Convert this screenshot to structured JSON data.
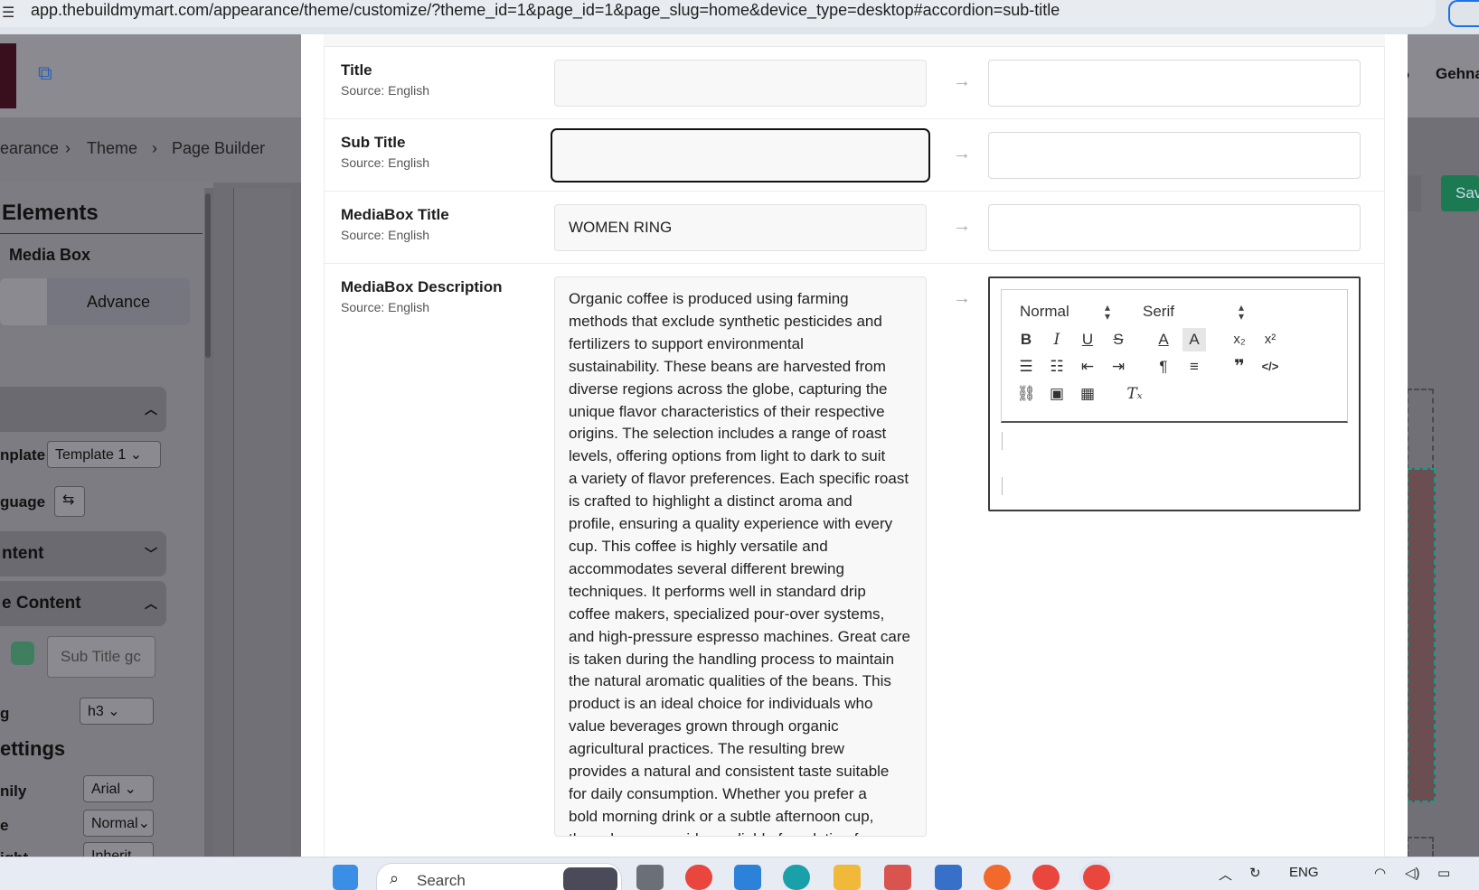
{
  "browser": {
    "url": "app.thebuildmymart.com/appearance/theme/customize/?theme_id=1&page_id=1&page_slug=home&device_type=desktop#accordion=sub-title"
  },
  "header": {
    "user_name": "Gehna"
  },
  "breadcrumb": {
    "items": [
      "earance",
      "Theme",
      "Page Builder"
    ]
  },
  "sidebar": {
    "title": "Elements",
    "element_name": "Media Box",
    "tab_advance": "Advance",
    "template_label": "nplate",
    "template_value": "Template 1",
    "language_label": "guage",
    "content_section": "ntent",
    "title_content_section": "e Content",
    "subtitle_placeholder": "Sub Title gc",
    "tag_label": "g",
    "tag_value": "h3",
    "settings_title": "ettings",
    "font_family_label": "nily",
    "font_family_value": "Arial",
    "font_style_label": "e",
    "font_style_value": "Normal",
    "font_weight_label": "ight",
    "font_weight_value": "Inherit"
  },
  "toolbar_bg": {
    "save_label": "Sav"
  },
  "modal": {
    "rows": [
      {
        "label": "Title",
        "source": "Source: English",
        "value": ""
      },
      {
        "label": "Sub Title",
        "source": "Source: English",
        "value": ""
      },
      {
        "label": "MediaBox Title",
        "source": "Source: English",
        "value": "WOMEN RING"
      },
      {
        "label": "MediaBox Description",
        "source": "Source: English"
      }
    ],
    "description_lines": [
      "Organic coffee is produced using farming",
      "methods that exclude synthetic pesticides and",
      "fertilizers to support environmental",
      "sustainability. These beans are harvested from",
      "diverse regions across the globe, capturing the",
      "unique flavor characteristics of their respective",
      "origins. The selection includes a range of roast",
      "levels, offering options from light to dark to suit",
      "a variety of flavor preferences. Each specific roast",
      "is crafted to highlight a distinct aroma and",
      "profile, ensuring a quality experience with every",
      "cup. This coffee is highly versatile and",
      "accommodates several different brewing",
      "techniques. It performs well in standard drip",
      "coffee makers, specialized pour-over systems,",
      "and high-pressure espresso machines. Great care",
      "is taken during the handling process to maintain",
      "the natural aromatic qualities of the beans. This",
      "product is an ideal choice for individuals who",
      "value beverages grown through organic",
      "agricultural practices. The resulting brew",
      "provides a natural and consistent taste suitable",
      "for daily consumption. Whether you prefer a",
      "bold morning drink or a subtle afternoon cup,",
      "these beans provide a reliable foundation for"
    ],
    "editor": {
      "header_select": "Normal",
      "font_select": "Serif"
    }
  },
  "taskbar": {
    "search_label": "Search",
    "language": "ENG"
  },
  "colors": {
    "accent_save": "#1c7a52",
    "focus_border": "#111111",
    "media_dashed": "#1a9b86"
  }
}
